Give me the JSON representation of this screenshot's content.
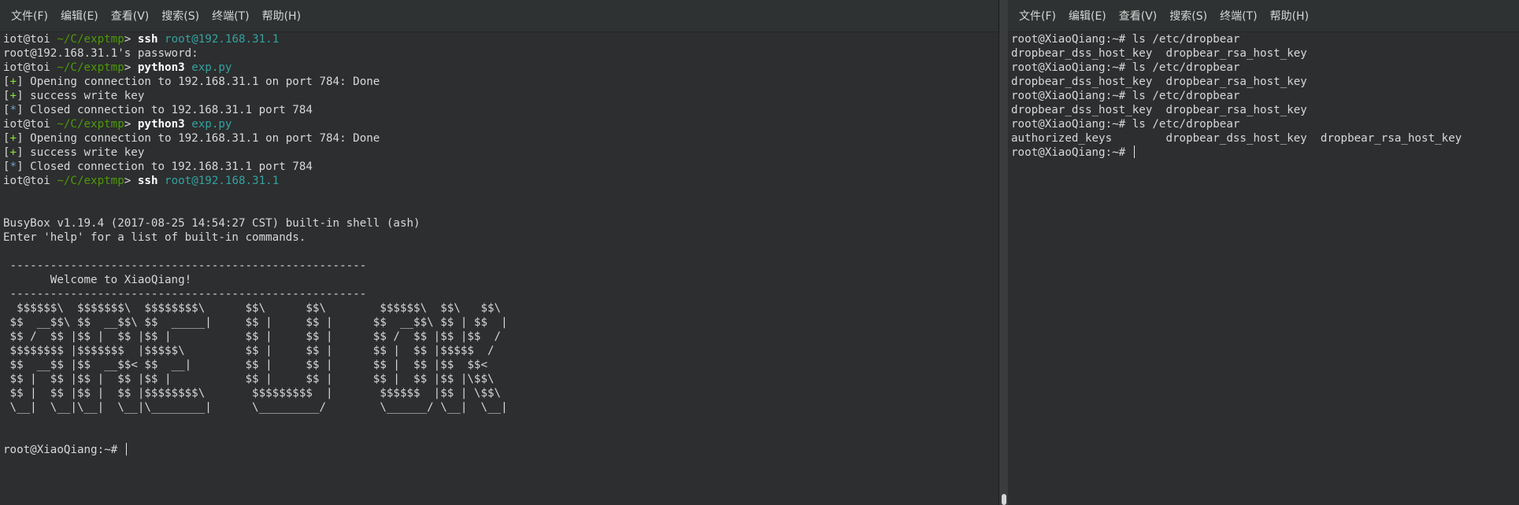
{
  "left_terminal": {
    "menu": [
      "文件(F)",
      "编辑(E)",
      "查看(V)",
      "搜索(S)",
      "终端(T)",
      "帮助(H)"
    ],
    "lines": [
      {
        "kind": "prompt",
        "user": "iot@toi",
        "path": "~/C/exptmp",
        "cmd": "ssh",
        "arg": "root@192.168.31.1"
      },
      {
        "kind": "text",
        "text": "root@192.168.31.1's password:"
      },
      {
        "kind": "prompt",
        "user": "iot@toi",
        "path": "~/C/exptmp",
        "cmd": "python3",
        "arg": "exp.py"
      },
      {
        "kind": "status",
        "marker": "+",
        "text": " Opening connection to 192.168.31.1 on port 784: Done"
      },
      {
        "kind": "status",
        "marker": "+",
        "text": " success write key"
      },
      {
        "kind": "status",
        "marker": "*",
        "text": " Closed connection to 192.168.31.1 port 784"
      },
      {
        "kind": "prompt",
        "user": "iot@toi",
        "path": "~/C/exptmp",
        "cmd": "python3",
        "arg": "exp.py"
      },
      {
        "kind": "status",
        "marker": "+",
        "text": " Opening connection to 192.168.31.1 on port 784: Done"
      },
      {
        "kind": "status",
        "marker": "+",
        "text": " success write key"
      },
      {
        "kind": "status",
        "marker": "*",
        "text": " Closed connection to 192.168.31.1 port 784"
      },
      {
        "kind": "prompt",
        "user": "iot@toi",
        "path": "~/C/exptmp",
        "cmd": "ssh",
        "arg": "root@192.168.31.1"
      },
      {
        "kind": "text",
        "text": ""
      },
      {
        "kind": "text",
        "text": ""
      },
      {
        "kind": "text",
        "text": "BusyBox v1.19.4 (2017-08-25 14:54:27 CST) built-in shell (ash)"
      },
      {
        "kind": "text",
        "text": "Enter 'help' for a list of built-in commands."
      },
      {
        "kind": "text",
        "text": ""
      },
      {
        "kind": "text",
        "text": " -----------------------------------------------------"
      },
      {
        "kind": "text",
        "text": "       Welcome to XiaoQiang!"
      },
      {
        "kind": "text",
        "text": " -----------------------------------------------------"
      },
      {
        "kind": "text",
        "text": "  $$$$$$\\  $$$$$$$\\  $$$$$$$$\\      $$\\      $$\\        $$$$$$\\  $$\\   $$\\"
      },
      {
        "kind": "text",
        "text": " $$  __$$\\ $$  __$$\\ $$  _____|     $$ |     $$ |      $$  __$$\\ $$ | $$  |"
      },
      {
        "kind": "text",
        "text": " $$ /  $$ |$$ |  $$ |$$ |           $$ |     $$ |      $$ /  $$ |$$ |$$  /"
      },
      {
        "kind": "text",
        "text": " $$$$$$$$ |$$$$$$$  |$$$$$\\         $$ |     $$ |      $$ |  $$ |$$$$$  /"
      },
      {
        "kind": "text",
        "text": " $$  __$$ |$$  __$$< $$  __|        $$ |     $$ |      $$ |  $$ |$$  $$<"
      },
      {
        "kind": "text",
        "text": " $$ |  $$ |$$ |  $$ |$$ |           $$ |     $$ |      $$ |  $$ |$$ |\\$$\\"
      },
      {
        "kind": "text",
        "text": " $$ |  $$ |$$ |  $$ |$$$$$$$$\\       $$$$$$$$$  |       $$$$$$  |$$ | \\$$\\"
      },
      {
        "kind": "text",
        "text": " \\__|  \\__|\\__|  \\__|\\________|      \\_________/        \\______/ \\__|  \\__|"
      },
      {
        "kind": "text",
        "text": ""
      },
      {
        "kind": "text",
        "text": ""
      },
      {
        "kind": "cursor",
        "text": "root@XiaoQiang:~# "
      }
    ]
  },
  "right_terminal": {
    "menu": [
      "文件(F)",
      "编辑(E)",
      "查看(V)",
      "搜索(S)",
      "终端(T)",
      "帮助(H)"
    ],
    "lines": [
      {
        "kind": "text",
        "text": "root@XiaoQiang:~# ls /etc/dropbear"
      },
      {
        "kind": "text",
        "text": "dropbear_dss_host_key  dropbear_rsa_host_key"
      },
      {
        "kind": "text",
        "text": "root@XiaoQiang:~# ls /etc/dropbear"
      },
      {
        "kind": "text",
        "text": "dropbear_dss_host_key  dropbear_rsa_host_key"
      },
      {
        "kind": "text",
        "text": "root@XiaoQiang:~# ls /etc/dropbear"
      },
      {
        "kind": "text",
        "text": "dropbear_dss_host_key  dropbear_rsa_host_key"
      },
      {
        "kind": "text",
        "text": "root@XiaoQiang:~# ls /etc/dropbear"
      },
      {
        "kind": "text",
        "text": "authorized_keys        dropbear_dss_host_key  dropbear_rsa_host_key"
      },
      {
        "kind": "cursor",
        "text": "root@XiaoQiang:~# "
      }
    ]
  }
}
